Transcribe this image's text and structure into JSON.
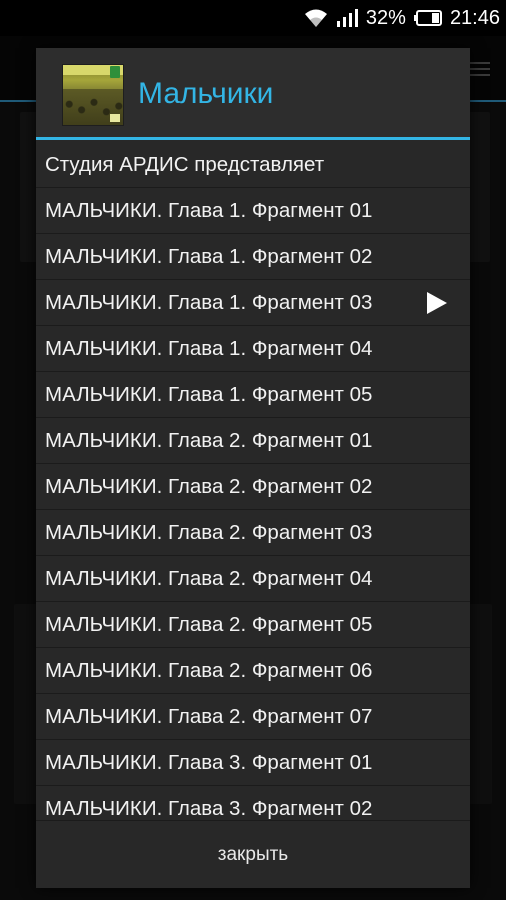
{
  "status_bar": {
    "battery_percent": "32%",
    "time": "21:46",
    "icons": [
      "wifi-icon",
      "signal-icon",
      "battery-icon"
    ]
  },
  "dialog": {
    "title": "Мальчики",
    "cover_icon": "album-cover-icon",
    "tracks": [
      {
        "label": "Студия АРДИС представляет",
        "playing": false
      },
      {
        "label": "МАЛЬЧИКИ. Глава 1. Фрагмент 01",
        "playing": false
      },
      {
        "label": "МАЛЬЧИКИ. Глава 1. Фрагмент 02",
        "playing": false
      },
      {
        "label": "МАЛЬЧИКИ. Глава 1. Фрагмент 03",
        "playing": true
      },
      {
        "label": "МАЛЬЧИКИ. Глава 1. Фрагмент 04",
        "playing": false
      },
      {
        "label": "МАЛЬЧИКИ. Глава 1. Фрагмент 05",
        "playing": false
      },
      {
        "label": "МАЛЬЧИКИ. Глава 2. Фрагмент 01",
        "playing": false
      },
      {
        "label": "МАЛЬЧИКИ. Глава 2. Фрагмент 02",
        "playing": false
      },
      {
        "label": "МАЛЬЧИКИ. Глава 2. Фрагмент 03",
        "playing": false
      },
      {
        "label": "МАЛЬЧИКИ. Глава 2. Фрагмент 04",
        "playing": false
      },
      {
        "label": "МАЛЬЧИКИ. Глава 2. Фрагмент 05",
        "playing": false
      },
      {
        "label": "МАЛЬЧИКИ. Глава 2. Фрагмент 06",
        "playing": false
      },
      {
        "label": "МАЛЬЧИКИ. Глава 2. Фрагмент 07",
        "playing": false
      },
      {
        "label": "МАЛЬЧИКИ. Глава 3. Фрагмент 01",
        "playing": false
      },
      {
        "label": "МАЛЬЧИКИ. Глава 3. Фрагмент 02",
        "playing": false
      }
    ],
    "close_label": "закрыть"
  },
  "colors": {
    "accent": "#33b5e5",
    "dialog_bg": "#282828",
    "text": "#f2f2f2"
  }
}
